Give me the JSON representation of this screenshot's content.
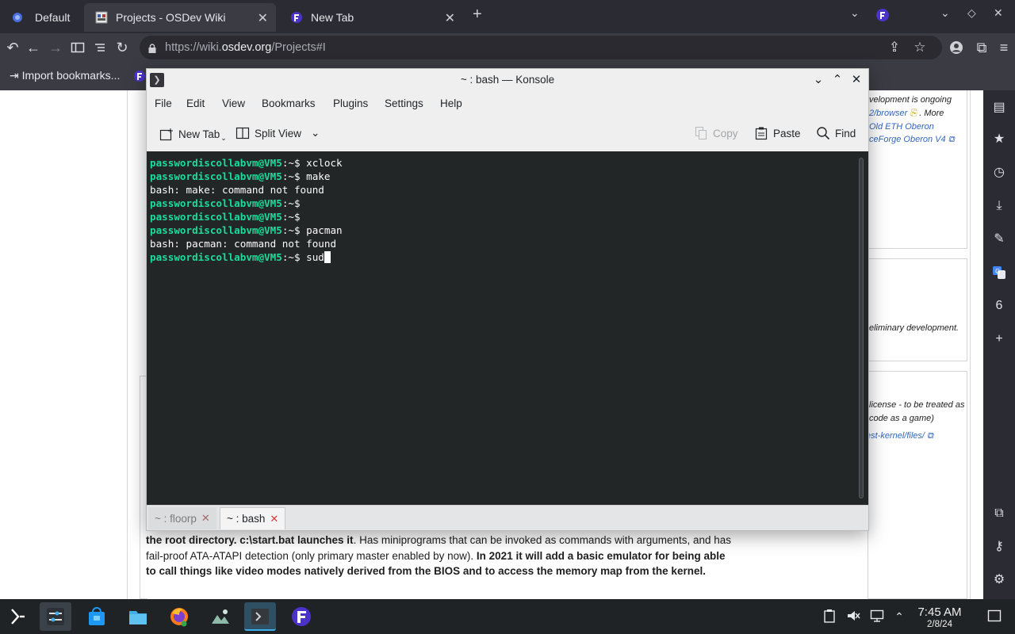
{
  "browser": {
    "tabs": [
      {
        "label": "Default",
        "icon": "floorp-globe-icon"
      },
      {
        "label": "Projects - OSDev Wiki",
        "icon": "osdev-favicon"
      },
      {
        "label": "New Tab",
        "icon": "floorp-logo-icon"
      }
    ],
    "new_tab_symbol": "+",
    "url_host_prefix": "https://wiki.",
    "url_host": "osdev.org",
    "url_path": "/Projects#I",
    "bookmark_import": "Import bookmarks..."
  },
  "page": {
    "snippets": [
      "velopment is ongoing",
      "2/browser",
      ". More",
      "Old ETH Oberon",
      "ceForge Oberon V4",
      "eliminary development.",
      "license - to be treated as",
      "code as a game)",
      "est-kernel/files/"
    ],
    "body": {
      "b1": "the root directory. c:\\start.bat launches it",
      "t1": ". Has miniprograms that can be invoked as commands with arguments, and has fail-proof ATA-ATAPI detection (only primary master enabled by now). ",
      "b2": "In 2021 it will add a basic emulator for being able to call things like video modes natively derived from the BIOS and to access the memory map from the kernel."
    }
  },
  "konsole": {
    "title": "~ : bash — Konsole",
    "menu": [
      "File",
      "Edit",
      "View",
      "Bookmarks",
      "Plugins",
      "Settings",
      "Help"
    ],
    "toolbar": {
      "new_tab": "New Tab",
      "split_view": "Split View",
      "copy": "Copy",
      "paste": "Paste",
      "find": "Find"
    },
    "prompt": "passwordiscollabvm@VM5",
    "prompt_suffix": ":~$",
    "lines": [
      {
        "type": "cmd",
        "text": " xclock"
      },
      {
        "type": "cmd",
        "text": " make"
      },
      {
        "type": "out",
        "text": "bash: make: command not found"
      },
      {
        "type": "cmd",
        "text": ""
      },
      {
        "type": "cmd",
        "text": ""
      },
      {
        "type": "cmd",
        "text": " pacman"
      },
      {
        "type": "out",
        "text": "bash: pacman: command not found"
      },
      {
        "type": "cmd",
        "text": " sud",
        "cursor": true
      }
    ],
    "tabs": [
      {
        "label": "~ : floorp",
        "active": false
      },
      {
        "label": "~ : bash",
        "active": true
      }
    ],
    "colors": {
      "prompt": "#1cdc9a",
      "background": "#232627",
      "text": "#fcfcfc"
    }
  },
  "taskbar": {
    "apps": [
      "application-launcher-icon",
      "system-settings-icon",
      "discover-store-icon",
      "dolphin-files-icon",
      "firefox-icon",
      "spectacle-icon",
      "konsole-icon",
      "floorp-icon"
    ],
    "clock_time": "7:45 AM",
    "clock_date": "2/8/24"
  }
}
